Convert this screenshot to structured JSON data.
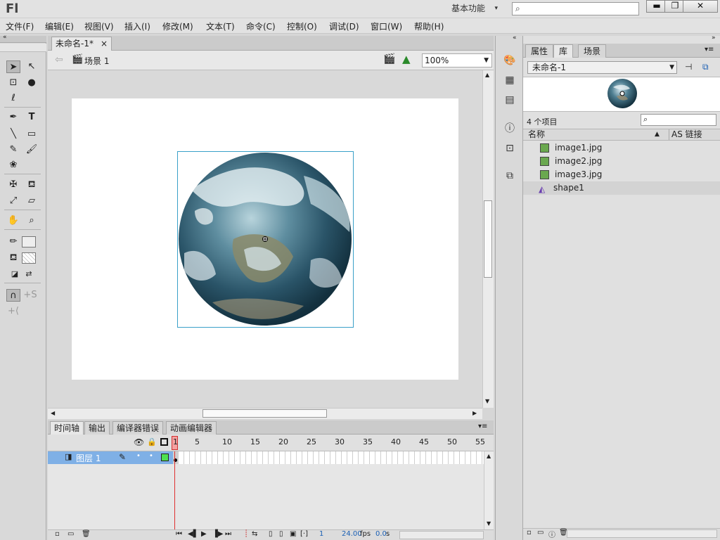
{
  "app": {
    "logo": "Fl",
    "workspace": "基本功能",
    "win_minimize": "▬",
    "win_restore": "❐",
    "win_close": "✕"
  },
  "menu": [
    "文件(F)",
    "编辑(E)",
    "视图(V)",
    "插入(I)",
    "修改(M)",
    "文本(T)",
    "命令(C)",
    "控制(O)",
    "调试(D)",
    "窗口(W)",
    "帮助(H)"
  ],
  "document": {
    "tab_label": "未命名-1*",
    "close": "×",
    "scene_label": "场景 1",
    "zoom": "100%"
  },
  "timeline": {
    "tabs": [
      "时间轴",
      "输出",
      "编译器错误",
      "动画编辑器"
    ],
    "frame_numbers": [
      "1",
      "5",
      "10",
      "15",
      "20",
      "25",
      "30",
      "35",
      "40",
      "45",
      "50",
      "55"
    ],
    "layer_name": "图层 1",
    "current_frame": "1",
    "fps": "24.00",
    "fps_unit": "fps",
    "elapsed": "0.0",
    "elapsed_unit": "s"
  },
  "library": {
    "tabs": [
      "属性",
      "库",
      "场景"
    ],
    "document_select": "未命名-1",
    "item_count": "4 个项目",
    "col_name": "名称",
    "col_linkage": "AS 链接",
    "items": [
      {
        "name": "image1.jpg",
        "type": "bitmap"
      },
      {
        "name": "image2.jpg",
        "type": "bitmap"
      },
      {
        "name": "image3.jpg",
        "type": "bitmap"
      },
      {
        "name": "shape1",
        "type": "graphic"
      }
    ]
  },
  "colors": {
    "accent": "#7fb0e6",
    "selection_stroke": "#3aa0c8",
    "playhead": "#e03030"
  }
}
